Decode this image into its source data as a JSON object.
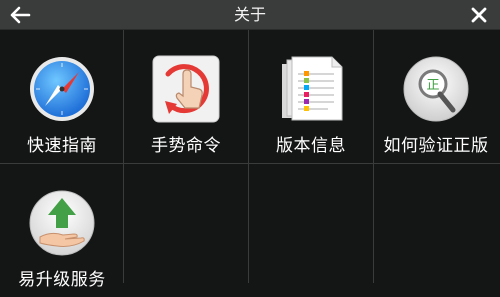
{
  "header": {
    "title": "关于",
    "back_icon": "back-arrow-icon",
    "close_icon": "close-icon"
  },
  "tiles": [
    {
      "label": "快速指南",
      "icon": "compass-icon"
    },
    {
      "label": "手势命令",
      "icon": "gesture-icon"
    },
    {
      "label": "版本信息",
      "icon": "document-icon"
    },
    {
      "label": "如何验证正版",
      "icon": "magnifier-verify-icon"
    },
    {
      "label": "易升级服务",
      "icon": "upgrade-icon"
    }
  ],
  "colors": {
    "background": "#141615",
    "header": "#3a3c3b",
    "divider": "#3a3c3b"
  }
}
